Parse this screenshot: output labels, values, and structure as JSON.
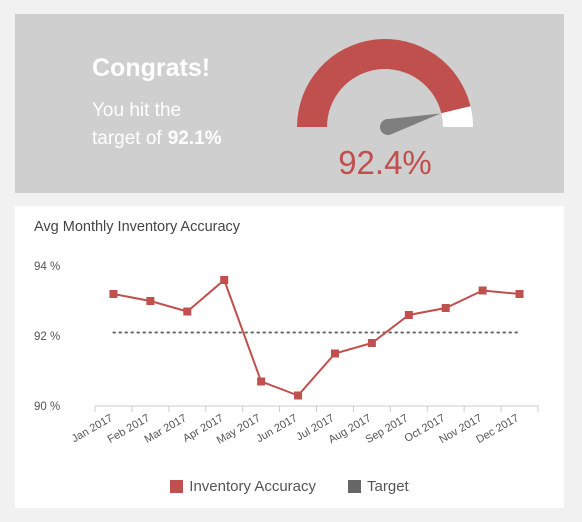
{
  "kpi": {
    "headline": "Congrats!",
    "message_line1": "You hit the",
    "message_line2": "target of",
    "target_value": "92.1%",
    "gauge_value_text": "92.4%",
    "gauge": {
      "min": 0,
      "max": 100,
      "value": 92.4
    }
  },
  "colors": {
    "accent": "#c0504d",
    "target": "#666666",
    "kpi_background": "#cfcfcf",
    "page_background": "#f1f1f1",
    "gauge_remainder": "#ffffff",
    "needle": "#7f7f7f"
  },
  "chart_data": {
    "type": "line",
    "title": "Avg Monthly Inventory Accuracy",
    "categories": [
      "Jan 2017",
      "Feb 2017",
      "Mar 2017",
      "Apr 2017",
      "May 2017",
      "Jun 2017",
      "Jul 2017",
      "Aug 2017",
      "Sep 2017",
      "Oct 2017",
      "Nov 2017",
      "Dec 2017"
    ],
    "series": [
      {
        "name": "Inventory Accuracy",
        "values": [
          93.2,
          93.0,
          92.7,
          93.6,
          90.7,
          90.3,
          91.5,
          91.8,
          92.6,
          92.8,
          93.3,
          93.2
        ]
      },
      {
        "name": "Target",
        "values": [
          92.1,
          92.1,
          92.1,
          92.1,
          92.1,
          92.1,
          92.1,
          92.1,
          92.1,
          92.1,
          92.1,
          92.1
        ]
      }
    ],
    "ylim": [
      90,
      94
    ],
    "yticks": [
      90,
      92,
      94
    ],
    "ytick_labels": [
      "90 %",
      "92 %",
      "94 %"
    ],
    "legend_position": "bottom",
    "grid": false
  }
}
